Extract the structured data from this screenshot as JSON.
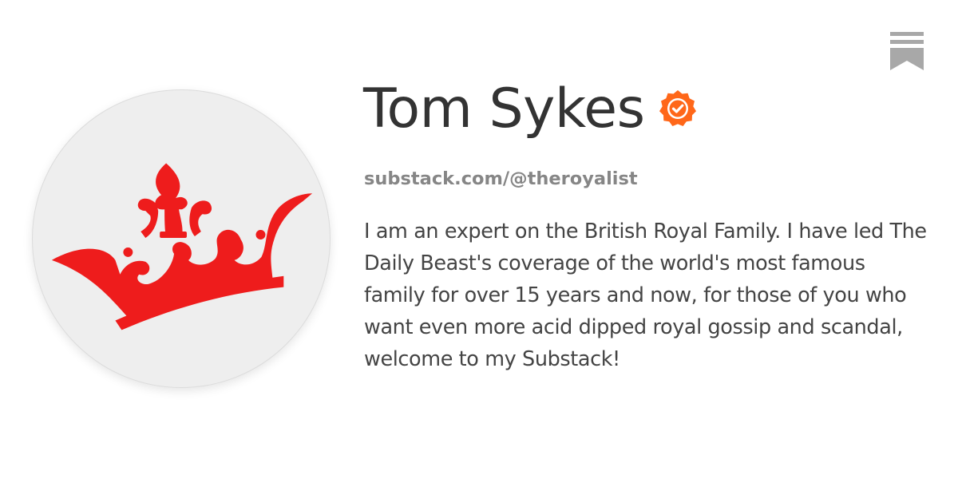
{
  "profile": {
    "name": "Tom Sykes",
    "handle": "substack.com/@theroyalist",
    "bio": "I am an expert on the British Royal Family. I have led The Daily Beast's coverage of the world's most famous family for over 15 years and now, for those of you who want even more acid dipped royal gossip and scandal, welcome to my Substack!",
    "avatar_icon": "crown-icon",
    "verified_icon": "verified-badge-icon"
  },
  "brand": {
    "logo_icon": "substack-bookmark-icon"
  },
  "colors": {
    "crown_red": "#ee1c1c",
    "verified_orange": "#ff6719",
    "logo_gray": "#a8a8a8",
    "avatar_bg": "#eeeeee",
    "name_text": "#333333",
    "handle_text": "#868686",
    "bio_text": "#444444"
  }
}
